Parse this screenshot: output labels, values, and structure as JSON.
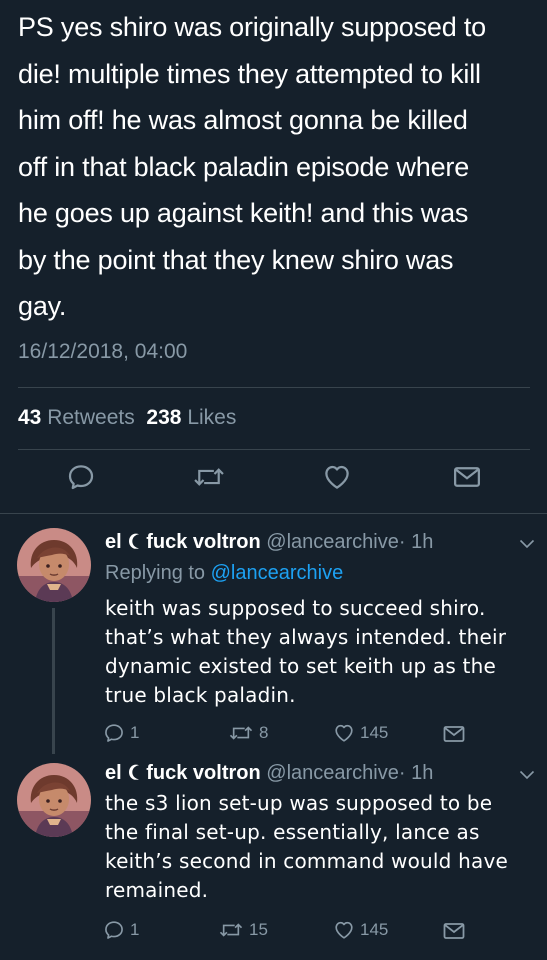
{
  "main_tweet": {
    "lines": [
      "PS yes shiro was originally supposed to",
      "die! multiple times they attempted to kill",
      "him off! he was almost gonna be killed",
      "off in that black paladin episode where",
      "he goes up against keith! and this was",
      "by the point that they knew shiro was",
      "gay."
    ],
    "timestamp": "16/12/2018, 04:00",
    "retweets_count": "43",
    "retweets_label": "Retweets",
    "likes_count": "238",
    "likes_label": "Likes"
  },
  "replies": [
    {
      "display_name_prefix": "el",
      "display_name_suffix": "fuck voltron",
      "handle": "@lancearchive",
      "time": "· 1h",
      "replying_label": "Replying to",
      "replying_to": "@lancearchive",
      "lines": [
        "keith was supposed to succeed shiro.",
        "that’s what they always intended. their",
        "dynamic existed to set keith up as the",
        "true black paladin."
      ],
      "reply_count": "1",
      "retweet_count": "8",
      "like_count": "145"
    },
    {
      "display_name_prefix": "el",
      "display_name_suffix": "fuck voltron",
      "handle": "@lancearchive",
      "time": "· 1h",
      "lines": [
        "the s3 lion set-up was supposed to be",
        "the final set-up. essentially, lance as",
        "keith’s second in command would have",
        "remained."
      ],
      "reply_count": "1",
      "retweet_count": "15",
      "like_count": "145"
    }
  ],
  "colors": {
    "background": "#15202b",
    "text": "#ffffff",
    "secondary": "#8899a6",
    "accent": "#1da1f2",
    "divider": "#38444d"
  },
  "icons": [
    "reply-icon",
    "retweet-icon",
    "like-icon",
    "share-icon",
    "caret-down-icon",
    "crescent-moon-icon",
    "avatar"
  ]
}
